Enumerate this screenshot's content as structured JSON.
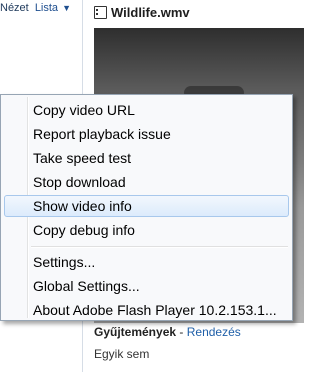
{
  "explorer": {
    "view_label": "Nézet",
    "view_value": "Lista",
    "view_arrow": "▼",
    "file_title": "Wildlife.wmv",
    "collections_title": "Gyűjtemények",
    "collections_dash": "-",
    "sort_link": "Rendezés",
    "none_text": "Egyik sem"
  },
  "context_menu": {
    "highlighted_index": 4,
    "groups": [
      {
        "items": [
          {
            "label": "Copy video URL"
          },
          {
            "label": "Report playback issue"
          },
          {
            "label": "Take speed test"
          },
          {
            "label": "Stop download"
          },
          {
            "label": "Show video info"
          },
          {
            "label": "Copy debug info"
          }
        ]
      },
      {
        "items": [
          {
            "label": "Settings..."
          },
          {
            "label": "Global Settings..."
          },
          {
            "label": "About Adobe Flash Player 10.2.153.1..."
          }
        ]
      }
    ]
  },
  "colors": {
    "menu_highlight": "#dcebfc",
    "link": "#1f5fa8"
  },
  "icons": {
    "file_icon": "video-file-icon",
    "view_dropdown": "chevron-down-icon"
  }
}
